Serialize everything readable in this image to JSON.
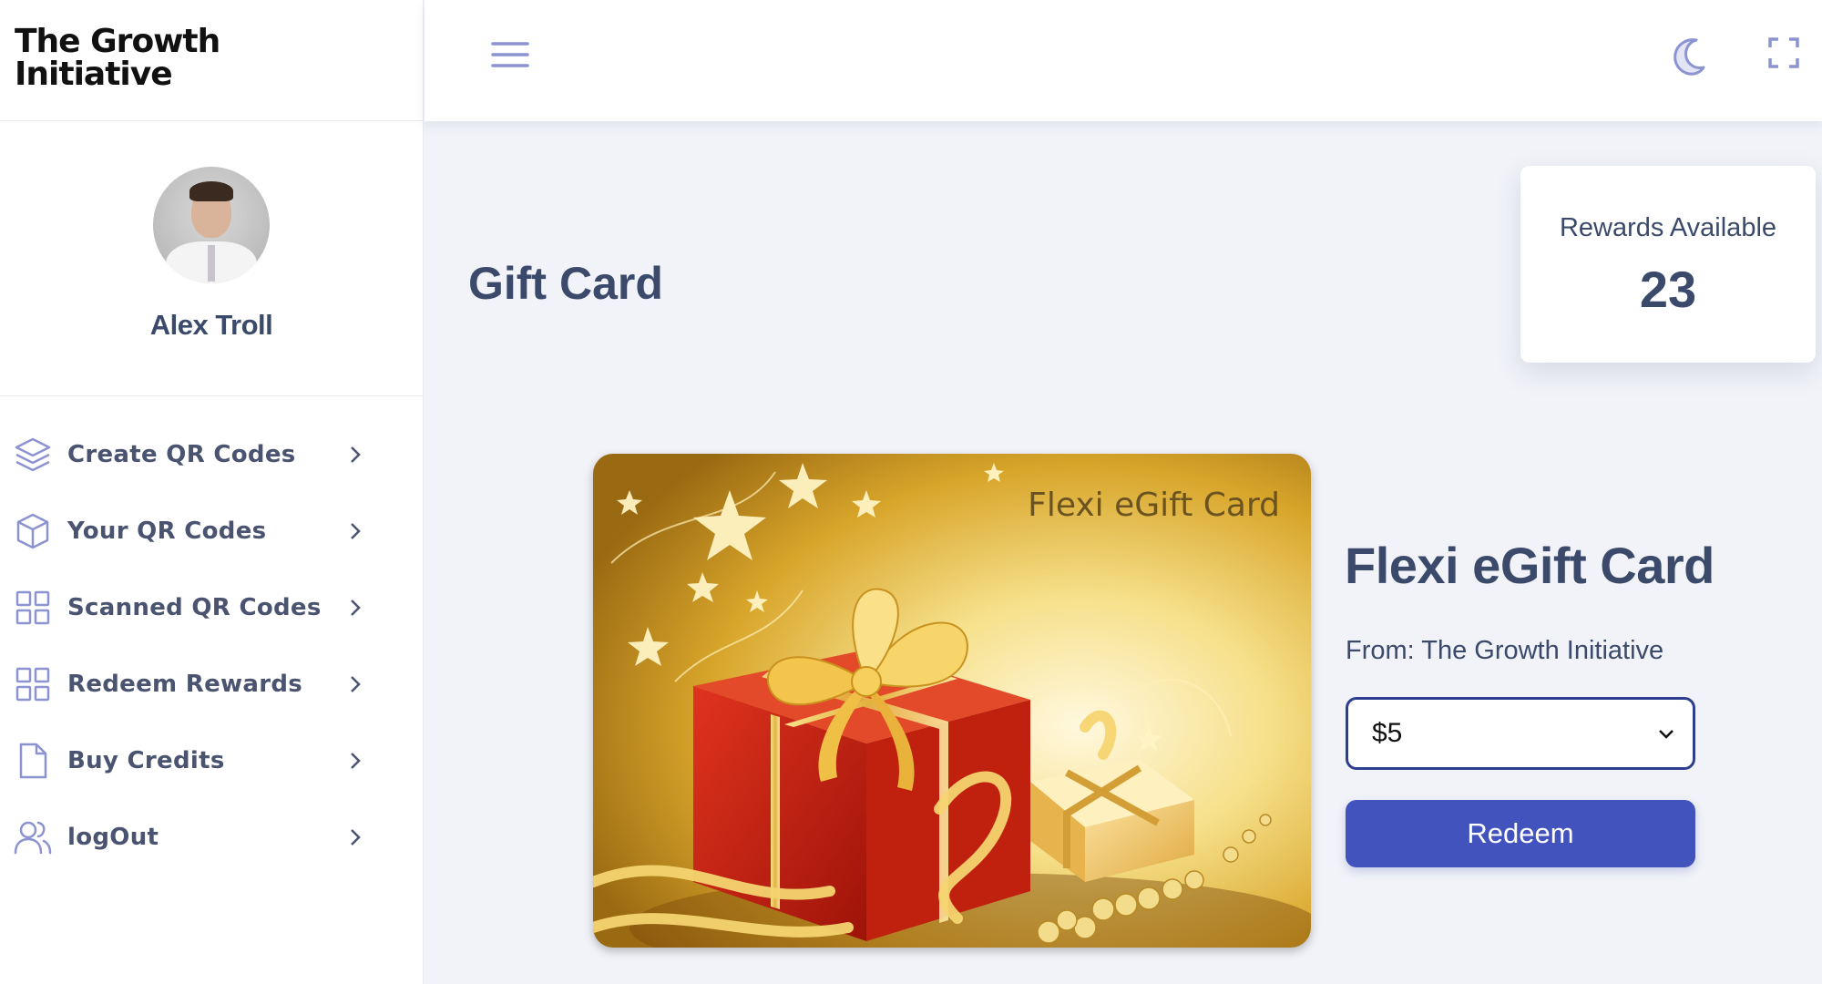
{
  "brand": {
    "name": "The Growth Initiative"
  },
  "profile": {
    "name": "Alex Troll"
  },
  "sidebar": {
    "items": [
      {
        "label": "Create QR Codes",
        "icon": "layers-icon"
      },
      {
        "label": "Your QR Codes",
        "icon": "box-icon"
      },
      {
        "label": "Scanned QR Codes",
        "icon": "grid-icon"
      },
      {
        "label": "Redeem Rewards",
        "icon": "grid-icon"
      },
      {
        "label": "Buy Credits",
        "icon": "file-icon"
      },
      {
        "label": "logOut",
        "icon": "users-icon"
      }
    ]
  },
  "header": {
    "icons": [
      "menu-icon",
      "moon-icon",
      "fullscreen-icon"
    ]
  },
  "page": {
    "title": "Gift Card"
  },
  "rewards": {
    "label": "Rewards Available",
    "value": "23"
  },
  "product": {
    "image_title": "Flexi eGift Card",
    "title": "Flexi eGift Card",
    "from": "From: The Growth Initiative",
    "selected_amount": "$5",
    "redeem_label": "Redeem"
  },
  "colors": {
    "accent": "#4253bd",
    "text": "#3b4a6b",
    "icon": "#8c93d1",
    "background": "#f1f3f8"
  }
}
